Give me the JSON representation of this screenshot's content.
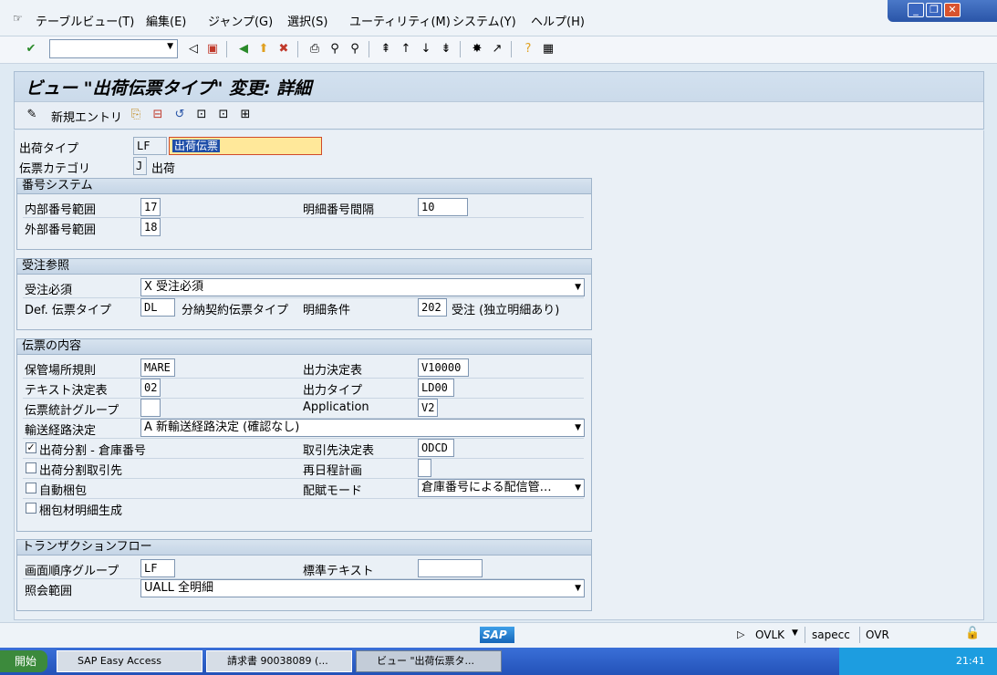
{
  "menubar": {
    "items": [
      "テーブルビュー(T)",
      "編集(E)",
      "ジャンプ(G)",
      "選択(S)",
      "ユーティリティ(M)",
      "システム(Y)",
      "ヘルプ(H)"
    ]
  },
  "window_controls": {
    "minimize": "_",
    "restore": "❐",
    "close": "✕"
  },
  "toolbar": {
    "command_field_value": ""
  },
  "title": "ビュー \"出荷伝票タイプ\" 変更: 詳細",
  "app_toolbar": {
    "new_entries_label": "新規エントリ"
  },
  "header": {
    "delivery_type_label": "出荷タイプ",
    "delivery_type_value": "LF",
    "delivery_type_text": "出荷伝票",
    "doc_category_label": "伝票カテゴリ",
    "doc_category_value": "J",
    "doc_category_text": "出荷"
  },
  "numbering": {
    "title": "番号システム",
    "internal_label": "内部番号範囲",
    "internal_value": "17",
    "external_label": "外部番号範囲",
    "external_value": "18",
    "item_incr_label": "明細番号間隔",
    "item_incr_value": "10"
  },
  "order_ref": {
    "title": "受注参照",
    "order_req_label": "受注必須",
    "order_req_value": "X 受注必須",
    "def_type_label": "Def. 伝票タイプ",
    "def_type_value": "DL",
    "def_type_text": "分納契約伝票タイプ",
    "item_req_label": "明細条件",
    "item_req_value": "202",
    "item_req_text": "受注 (独立明細あり)"
  },
  "doc_content": {
    "title": "伝票の内容",
    "storage_rule_label": "保管場所規則",
    "storage_rule_value": "MARE",
    "output_proc_label": "出力決定表",
    "output_proc_value": "V10000",
    "text_proc_label": "テキスト決定表",
    "text_proc_value": "02",
    "output_type_label": "出力タイプ",
    "output_type_value": "LD00",
    "stat_group_label": "伝票統計グループ",
    "stat_group_value": "",
    "application_label": "Application",
    "application_value": "V2",
    "route_label": "輸送経路決定",
    "route_value": "A 新輸送経路決定 (確認なし)",
    "split_wh_label": "出荷分割 - 倉庫番号",
    "split_wh_checked": true,
    "split_partner_label": "出荷分割取引先",
    "split_partner_checked": false,
    "partner_proc_label": "取引先決定表",
    "partner_proc_value": "ODCD",
    "reschedule_label": "再日程計画",
    "reschedule_value": "",
    "auto_pack_label": "自動梱包",
    "auto_pack_checked": false,
    "distrib_mode_label": "配賦モード",
    "distrib_mode_value": "倉庫番号による配信管…",
    "pack_item_label": "梱包材明細生成",
    "pack_item_checked": false
  },
  "transaction_flow": {
    "title": "トランザクションフロー",
    "screen_seq_label": "画面順序グループ",
    "screen_seq_value": "LF",
    "std_text_label": "標準テキスト",
    "std_text_value": "",
    "display_range_label": "照会範囲",
    "display_range_value": "UALL 全明細"
  },
  "statusbar": {
    "logo": "SAP",
    "tcode": "OVLK",
    "system": "sapecc",
    "mode": "OVR"
  },
  "taskbar": {
    "start_label": "開始",
    "tasks": [
      "SAP Easy Access",
      "請求書 90038089 (...",
      "ビュー \"出荷伝票タ..."
    ],
    "clock": "21:41"
  }
}
